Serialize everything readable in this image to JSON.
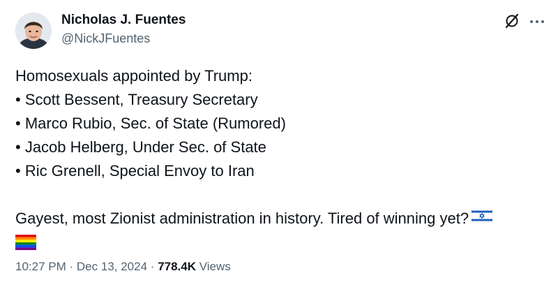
{
  "author": {
    "name": "Nicholas J. Fuentes",
    "handle": "@NickJFuentes"
  },
  "post": {
    "lines": [
      "Homosexuals appointed by Trump:",
      "• Scott Bessent, Treasury Secretary",
      "• Marco Rubio, Sec. of State (Rumored)",
      "• Jacob Helberg, Under Sec. of State",
      "• Ric Grenell, Special Envoy to Iran"
    ],
    "closing": "Gayest, most Zionist administration in history. Tired of winning yet?",
    "emojis": [
      "israel-flag-icon",
      "rainbow-flag-icon"
    ]
  },
  "meta": {
    "time": "10:27 PM",
    "separator": "·",
    "date": "Dec 13, 2024",
    "views_count": "778.4K",
    "views_label": "Views"
  },
  "colors": {
    "text": "#0f1419",
    "secondary": "#536471"
  },
  "icons": {
    "grok": "grok-icon",
    "more": "more-icon"
  }
}
